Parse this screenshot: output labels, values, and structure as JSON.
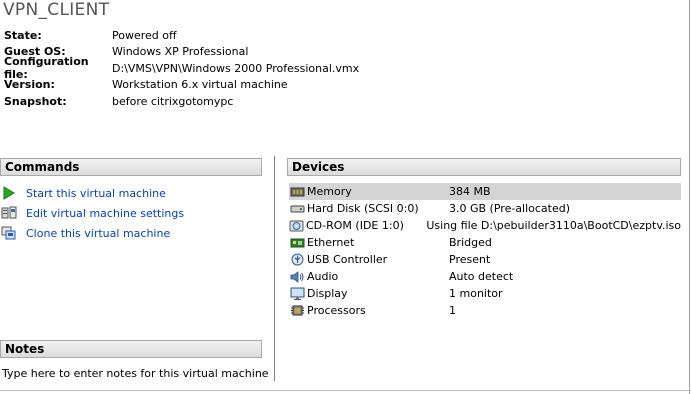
{
  "vm": {
    "title": "VPN_CLIENT"
  },
  "info": [
    {
      "label": "State:",
      "value": "Powered off"
    },
    {
      "label": "Guest OS:",
      "value": "Windows XP Professional"
    },
    {
      "label": "Configuration file:",
      "value": "D:\\VMS\\VPN\\Windows 2000 Professional.vmx"
    },
    {
      "label": "Version:",
      "value": "Workstation 6.x virtual machine"
    },
    {
      "label": "Snapshot:",
      "value": "before citrixgotomypc"
    }
  ],
  "commands": {
    "header": "Commands",
    "items": [
      {
        "label": "Start this virtual machine",
        "icon": "play-icon"
      },
      {
        "label": "Edit virtual machine settings",
        "icon": "settings-icon"
      },
      {
        "label": "Clone this virtual machine",
        "icon": "clone-icon"
      }
    ]
  },
  "devices": {
    "header": "Devices",
    "items": [
      {
        "name": "Memory",
        "summary": "384 MB",
        "icon": "memory-icon",
        "selected": true
      },
      {
        "name": "Hard Disk (SCSI 0:0)",
        "summary": "3.0 GB (Pre-allocated)",
        "icon": "harddisk-icon"
      },
      {
        "name": "CD-ROM (IDE 1:0)",
        "summary": "Using file D:\\pebuilder3110a\\BootCD\\ezptv.iso",
        "icon": "cdrom-icon"
      },
      {
        "name": "Ethernet",
        "summary": "Bridged",
        "icon": "ethernet-icon"
      },
      {
        "name": "USB Controller",
        "summary": "Present",
        "icon": "usb-icon"
      },
      {
        "name": "Audio",
        "summary": "Auto detect",
        "icon": "audio-icon"
      },
      {
        "name": "Display",
        "summary": "1 monitor",
        "icon": "display-icon"
      },
      {
        "name": "Processors",
        "summary": "1",
        "icon": "processor-icon"
      }
    ]
  },
  "notes": {
    "header": "Notes",
    "placeholder": "Type here to enter notes for this virtual machine"
  },
  "colors": {
    "link": "#0645ad",
    "selected_row": "#d4d4d4",
    "play_green": "#2aa52a"
  }
}
